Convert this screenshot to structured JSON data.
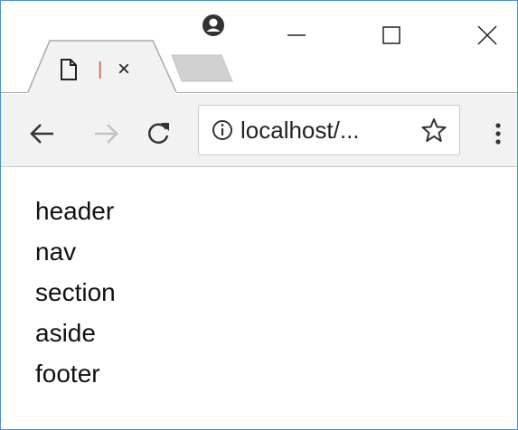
{
  "browser": {
    "tab": {
      "page_icon": "document-icon",
      "loading_mark": "|",
      "close_label": "×"
    },
    "new_tab_icon": "new-tab-icon",
    "profile_icon": "profile-icon",
    "window_controls": [
      "minimize-icon",
      "maximize-icon",
      "close-icon"
    ],
    "toolbar": {
      "back_icon": "back-arrow-icon",
      "forward_icon": "forward-arrow-icon",
      "reload_icon": "reload-icon",
      "address": "localhost/...",
      "info_icon": "info-icon",
      "bookmark_icon": "star-icon",
      "menu_icon": "kebab-menu-icon"
    },
    "colors": {
      "window_border": "#4a90d9",
      "toolbar_bg": "#f2f2f2",
      "loading_accent": "#e0553b",
      "inactive_tab": "#d0d0d0"
    }
  },
  "page": {
    "items": [
      "header",
      "nav",
      "section",
      "aside",
      "footer"
    ]
  }
}
